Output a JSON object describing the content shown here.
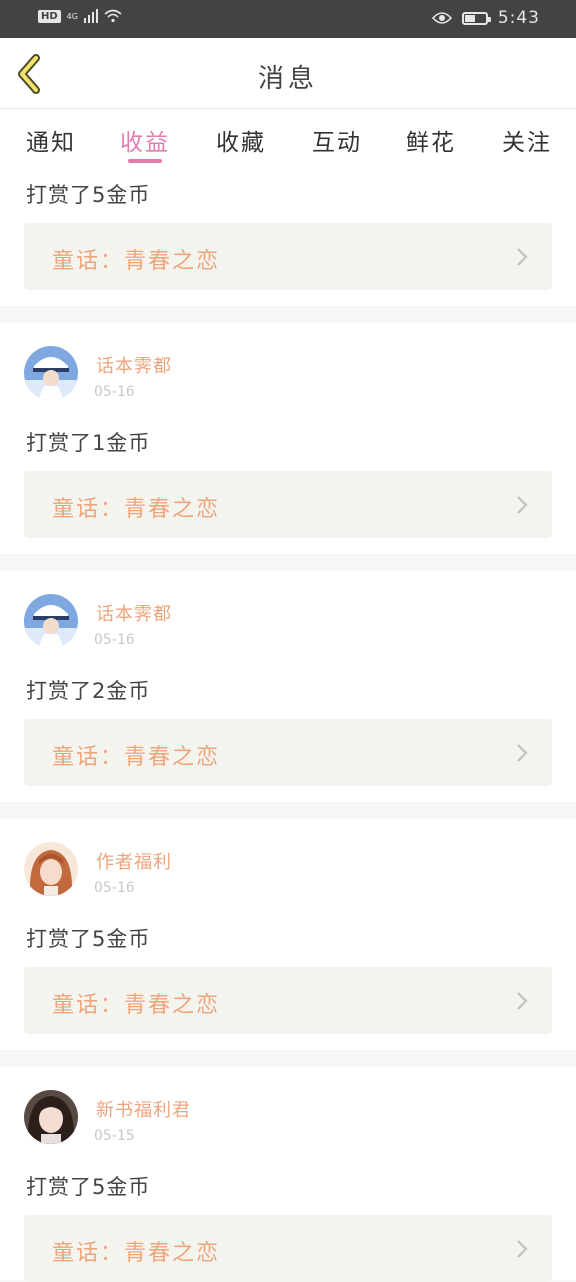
{
  "status_bar": {
    "hd": "HD",
    "network": "4G",
    "time": "5:43",
    "battery_level": 0.45
  },
  "header": {
    "title": "消息",
    "back_icon": "chevron-left-icon"
  },
  "tabs": [
    {
      "label": "通知",
      "active": false
    },
    {
      "label": "收益",
      "active": true
    },
    {
      "label": "收藏",
      "active": false
    },
    {
      "label": "互动",
      "active": false
    },
    {
      "label": "鲜花",
      "active": false
    },
    {
      "label": "关注",
      "active": false
    }
  ],
  "colors": {
    "accent": "#e37cae",
    "name": "#eda57c",
    "book_text": "#eea57e",
    "book_bg": "#f4f4ee"
  },
  "messages": [
    {
      "user": "",
      "date": "",
      "reward": "打赏了5金币",
      "book": "童话：青春之恋"
    },
    {
      "user": "话本霁都",
      "date": "05-16",
      "reward": "打赏了1金币",
      "book": "童话：青春之恋"
    },
    {
      "user": "话本霁都",
      "date": "05-16",
      "reward": "打赏了2金币",
      "book": "童话：青春之恋"
    },
    {
      "user": "作者福利",
      "date": "05-16",
      "reward": "打赏了5金币",
      "book": "童话：青春之恋"
    },
    {
      "user": "新书福利君",
      "date": "05-15",
      "reward": "打赏了5金币",
      "book": "童话：青春之恋"
    }
  ]
}
